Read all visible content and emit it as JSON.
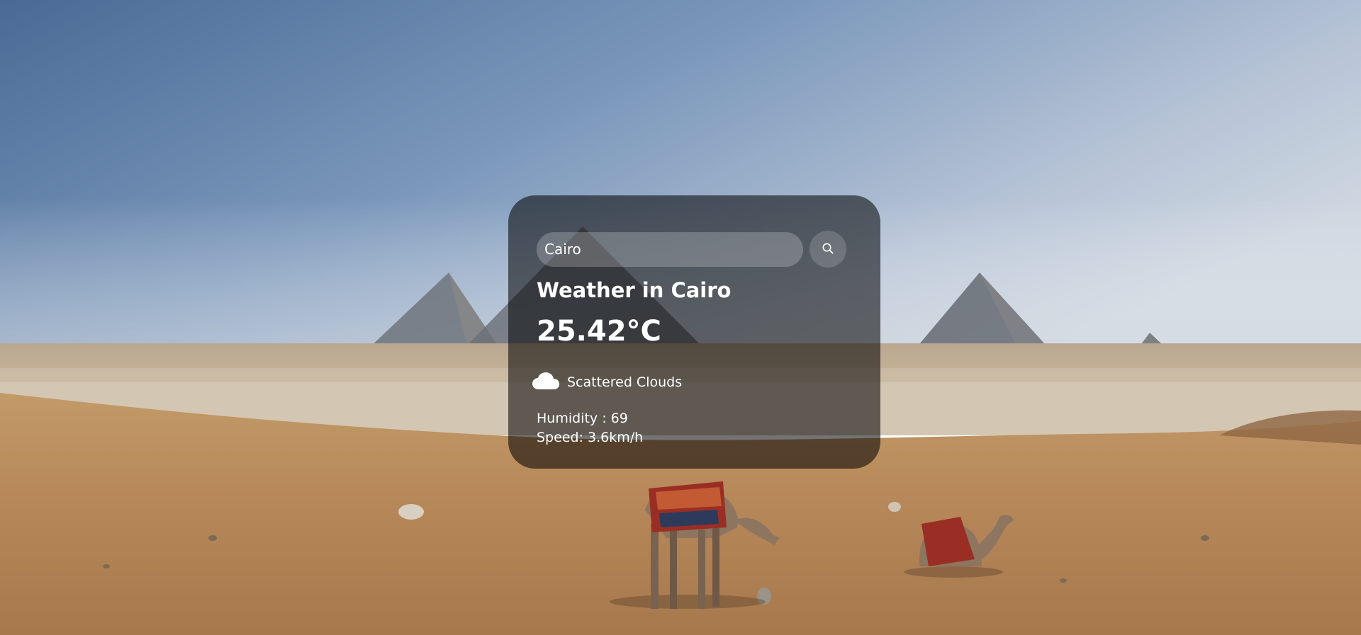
{
  "search": {
    "value": "Cairo",
    "placeholder": "Search"
  },
  "weather": {
    "title": "Weather in Cairo",
    "temperature": "25.42°C",
    "description": "Scattered Clouds",
    "icon": "cloud-icon",
    "humidity": "Humidity : 69",
    "speed": "Speed: 3.6km/h"
  },
  "colors": {
    "card_bg": "rgba(0,0,0,0.55)",
    "text": "#ffffff",
    "sky_top": "#4d6f99",
    "sand": "#b98a55"
  }
}
